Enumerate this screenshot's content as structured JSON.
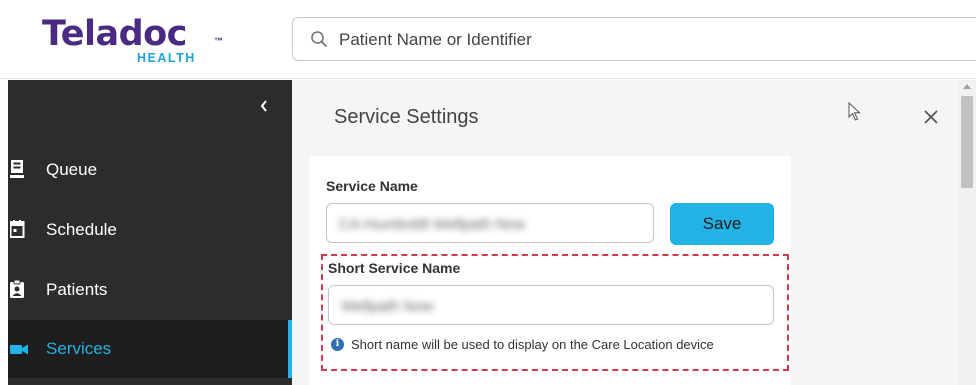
{
  "brand": {
    "name": "Teladoc",
    "trademark": "™",
    "subtitle": "HEALTH",
    "primary_color": "#4b2a83",
    "accent_color": "#1fa3d9"
  },
  "search": {
    "placeholder": "Patient Name or Identifier",
    "icon": "search-icon"
  },
  "sidebar": {
    "collapse_icon": "chevron-left-icon",
    "items": [
      {
        "label": "Queue",
        "icon": "queue-icon",
        "active": false
      },
      {
        "label": "Schedule",
        "icon": "calendar-icon",
        "active": false
      },
      {
        "label": "Patients",
        "icon": "patient-badge-icon",
        "active": false
      },
      {
        "label": "Services",
        "icon": "video-camera-icon",
        "active": true
      }
    ],
    "active_color": "#22b2e6"
  },
  "panel": {
    "title": "Service Settings",
    "close_icon": "close-icon",
    "service_name_label": "Service Name",
    "service_name_value": "CA-Humboldt Wellpath Now",
    "save_label": "Save",
    "short_name_label": "Short Service Name",
    "short_name_value": "Wellpath Now",
    "info_icon": "info-icon",
    "info_text": "Short name will be used to display on the Care Location device",
    "highlight_color": "#d03a4c"
  }
}
